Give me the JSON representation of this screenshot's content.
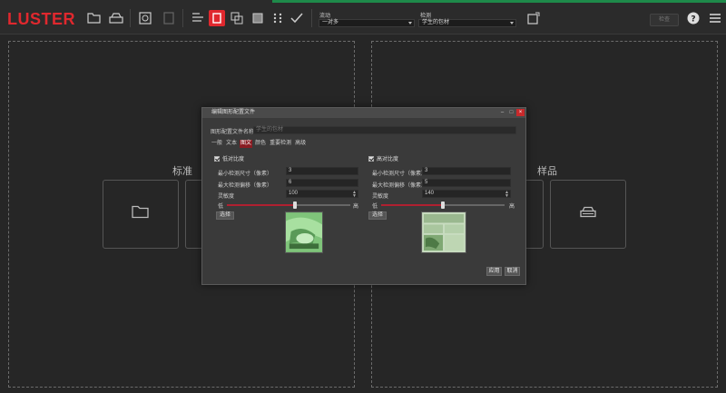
{
  "app": {
    "logo": "LUSTER"
  },
  "toolbar": {
    "flow_label": "流动",
    "flow_value": "一对多",
    "detect_label": "检测",
    "detect_value": "学生的包材",
    "check_button": "检查"
  },
  "panels": {
    "left_title": "标准",
    "right_title": "样品"
  },
  "dialog": {
    "title": "编辑图形配置文件",
    "config_name_label": "图形配置文件名称",
    "config_name_placeholder": "学生的包材",
    "tabs": [
      "一般",
      "文本",
      "图文",
      "颜色",
      "重要检测",
      "高级"
    ],
    "active_tab_index": 2,
    "left": {
      "checkbox_label": "低对比度",
      "min_size_label": "最小检测尺寸（像素）",
      "min_size_value": "3",
      "max_offset_label": "最大检测偏移（像素）",
      "max_offset_value": "6",
      "sensitivity_label": "灵敏度",
      "sensitivity_value": "100",
      "slider_low": "低",
      "slider_high": "高",
      "slider_level": 0.55,
      "select_button": "选择"
    },
    "right": {
      "checkbox_label": "高对比度",
      "min_size_label": "最小检测尺寸（像素）",
      "min_size_value": "3",
      "max_offset_label": "最大检测偏移（像素）",
      "max_offset_value": "5",
      "sensitivity_label": "灵敏度",
      "sensitivity_value": "140",
      "slider_low": "低",
      "slider_high": "高",
      "slider_level": 0.5,
      "select_button": "选择"
    },
    "apply_button": "应用",
    "cancel_button": "取消"
  },
  "colors": {
    "brand": "#e0282e",
    "active_tab": "#8a1c22",
    "slider_fill": "#b02030"
  }
}
